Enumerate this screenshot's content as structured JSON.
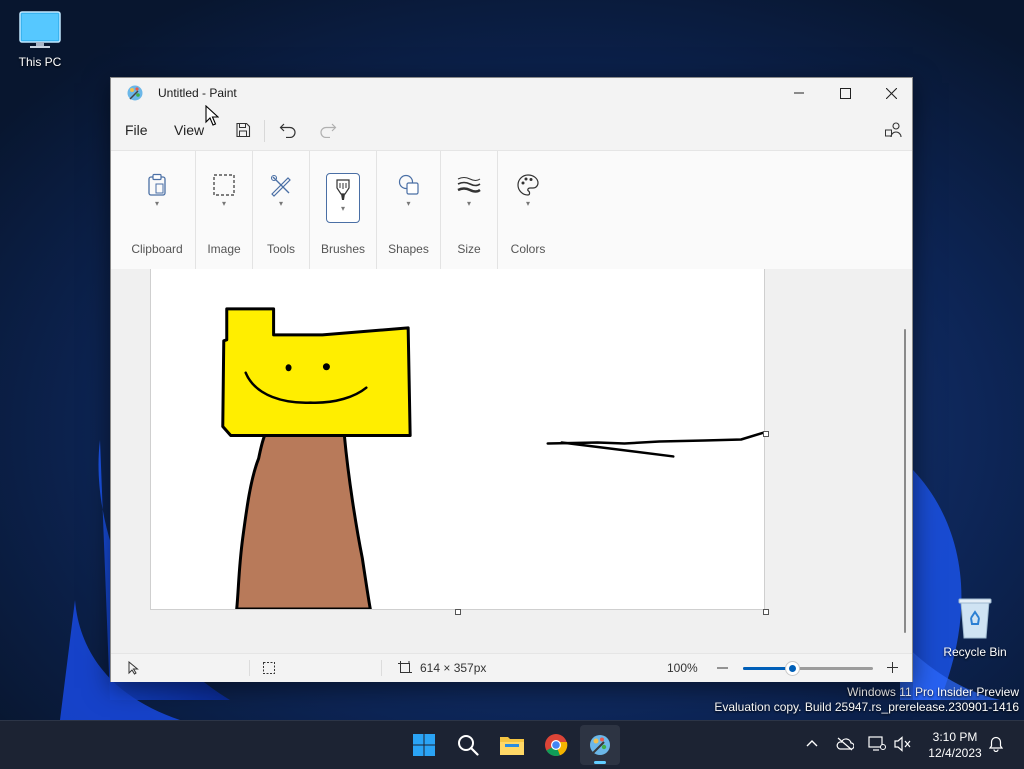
{
  "desktop": {
    "this_pc_label": "This PC",
    "recycle_bin_label": "Recycle Bin",
    "watermark_line1": "Windows 11 Pro Insider Preview",
    "watermark_line2": "Evaluation copy. Build 25947.rs_prerelease.230901-1416"
  },
  "window": {
    "title": "Untitled - Paint",
    "menu": {
      "file": "File",
      "view": "View"
    },
    "icons": [
      "paint-app-icon",
      "minimize-icon",
      "maximize-icon",
      "close-icon",
      "save-icon",
      "undo-icon",
      "redo-icon",
      "account-icon"
    ]
  },
  "ribbon": {
    "groups": [
      {
        "label": "Clipboard",
        "icon": "clipboard-icon"
      },
      {
        "label": "Image",
        "icon": "selection-icon"
      },
      {
        "label": "Tools",
        "icon": "tools-icon"
      },
      {
        "label": "Brushes",
        "icon": "brush-icon",
        "selected": true
      },
      {
        "label": "Shapes",
        "icon": "shapes-icon"
      },
      {
        "label": "Size",
        "icon": "size-icon"
      },
      {
        "label": "Colors",
        "icon": "palette-icon"
      }
    ]
  },
  "canvas": {
    "fill_colors": {
      "yellow": "#ffee00",
      "brown": "#b87a5a",
      "stroke": "#000000"
    }
  },
  "status": {
    "canvas_size": "614 × 357px",
    "zoom": "100%",
    "zoom_slider_fraction": 0.38
  },
  "taskbar": {
    "time": "3:10 PM",
    "date": "12/4/2023",
    "accent": "#60cdff"
  }
}
